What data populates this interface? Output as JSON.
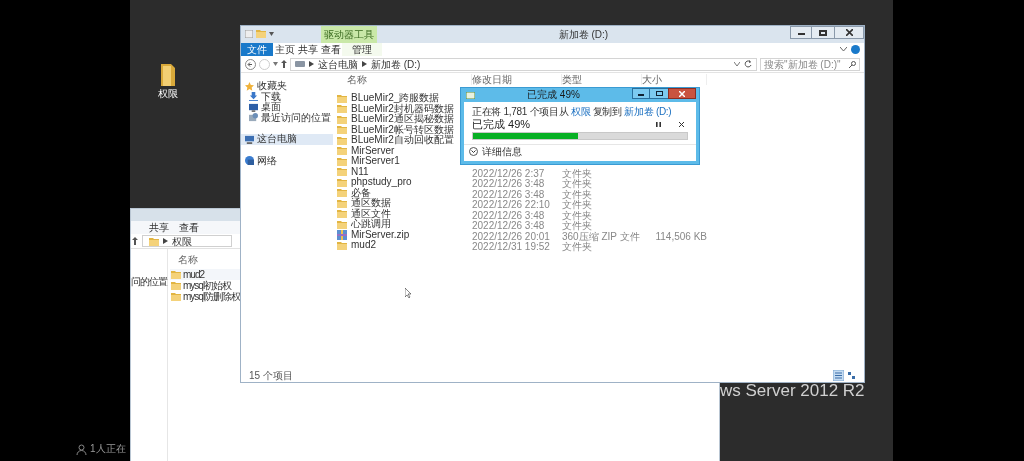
{
  "desktop": {
    "icons": [
      {
        "label": "权限"
      }
    ],
    "branding": "ws Server 2012 R2"
  },
  "overlay_caption": "1人正在",
  "back_window": {
    "ribbon_tabs": [
      {
        "label": "共享"
      },
      {
        "label": "查看"
      }
    ],
    "address": [
      "权限"
    ],
    "sidebar_items": [
      {
        "label": "问的位置"
      }
    ],
    "columns": [
      "名称"
    ],
    "files": [
      {
        "name": "mud2"
      },
      {
        "name": "mysql初始权"
      },
      {
        "name": "mysql防删除权"
      }
    ]
  },
  "explorer": {
    "title": "新加卷 (D:)",
    "context_header": "驱动器工具",
    "ribbon_tabs": [
      {
        "label": "文件",
        "kind": "file"
      },
      {
        "label": "主页",
        "kind": "tab"
      },
      {
        "label": "共享",
        "kind": "tab"
      },
      {
        "label": "查看",
        "kind": "tab"
      },
      {
        "label": "管理",
        "kind": "context"
      }
    ],
    "address": [
      "这台电脑",
      "新加卷 (D:)"
    ],
    "search": {
      "placeholder": "搜索\"新加卷 (D:)\""
    },
    "sidebar": [
      {
        "label": "收藏夹",
        "kind": "favorites",
        "selected": false,
        "children": [
          {
            "label": "下载",
            "kind": "downloads",
            "selected": false
          },
          {
            "label": "桌面",
            "kind": "desktop",
            "selected": false
          },
          {
            "label": "最近访问的位置",
            "kind": "recent",
            "selected": false
          }
        ]
      },
      {
        "label": "这台电脑",
        "kind": "computer",
        "selected": true
      },
      {
        "label": "网络",
        "kind": "network",
        "selected": false
      }
    ],
    "columns": [
      "名称",
      "修改日期",
      "类型",
      "大小"
    ],
    "files": [
      {
        "name": "BLueMir2_跨服数据",
        "kind": "folder"
      },
      {
        "name": "BLueMir2封机器码数据",
        "kind": "folder"
      },
      {
        "name": "BLueMir2通区揭秘数据",
        "kind": "folder"
      },
      {
        "name": "BLueMir2帐号转区数据",
        "kind": "folder"
      },
      {
        "name": "BLueMir2自动回收配置",
        "kind": "folder"
      },
      {
        "name": "MirServer",
        "kind": "folder"
      },
      {
        "name": "MirServer1",
        "kind": "folder"
      },
      {
        "name": "N11",
        "kind": "folder",
        "date": "2022/12/26 2:37",
        "type": "文件夹"
      },
      {
        "name": "phpstudy_pro",
        "kind": "folder",
        "date": "2022/12/26 3:48",
        "type": "文件夹"
      },
      {
        "name": "必备",
        "kind": "folder",
        "date": "2022/12/26 3:48",
        "type": "文件夹"
      },
      {
        "name": "通区数据",
        "kind": "folder",
        "date": "2022/12/26 22:10",
        "type": "文件夹"
      },
      {
        "name": "通区文件",
        "kind": "folder",
        "date": "2022/12/26 3:48",
        "type": "文件夹"
      },
      {
        "name": "心跳调用",
        "kind": "folder",
        "date": "2022/12/26 3:48",
        "type": "文件夹"
      },
      {
        "name": "MirServer.zip",
        "kind": "zip",
        "date": "2022/12/26 20:01",
        "type": "360压缩 ZIP 文件",
        "size": "114,506 KB"
      },
      {
        "name": "mud2",
        "kind": "folder",
        "date": "2022/12/31 19:52",
        "type": "文件夹"
      }
    ],
    "status_bar": "15 个项目"
  },
  "copy_dialog": {
    "title": "已完成 49%",
    "message": [
      {
        "text": "正在将 1,781 个项目从 ",
        "kind": "text"
      },
      {
        "text": "权限",
        "kind": "link"
      },
      {
        "text": " 复制到 ",
        "kind": "text"
      },
      {
        "text": "新加卷 (D:)",
        "kind": "link"
      }
    ],
    "status": "已完成 49%",
    "progress": {
      "level": 0.49
    },
    "details": "详细信息"
  }
}
